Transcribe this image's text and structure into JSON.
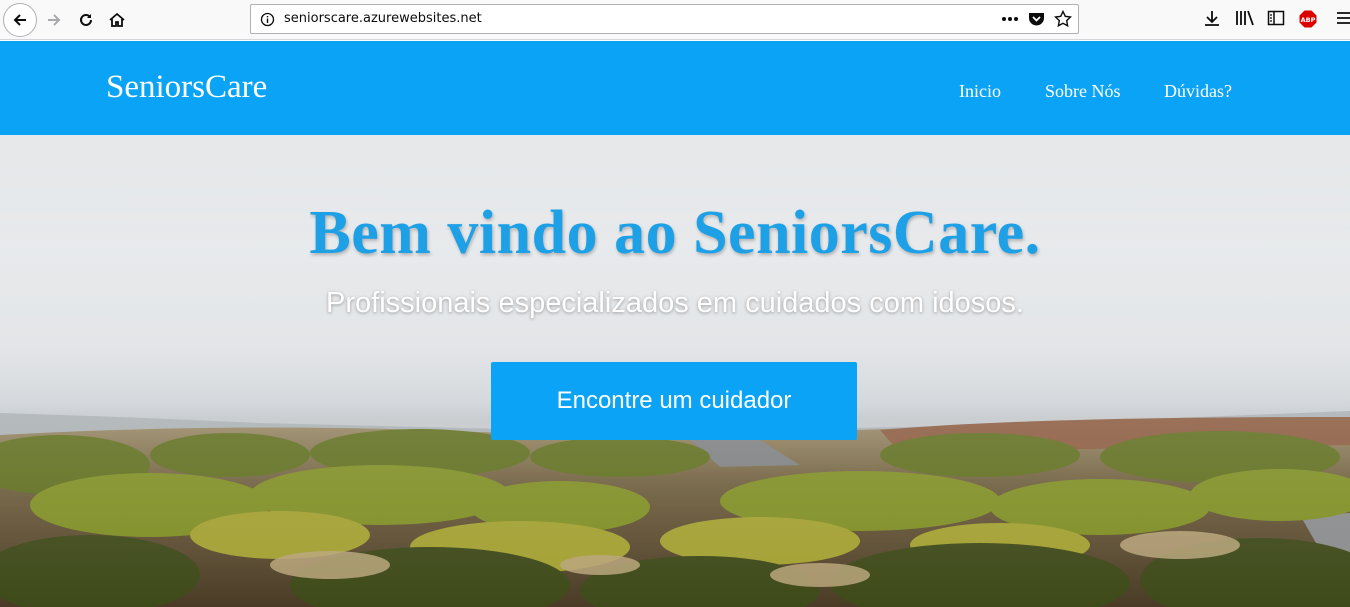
{
  "browser": {
    "url": "seniorscare.azurewebsites.net",
    "abp_label": "ABP",
    "icons": [
      "back-icon",
      "forward-icon",
      "reload-icon",
      "home-icon",
      "info-icon",
      "more-dots-icon",
      "pocket-icon",
      "bookmark-star-icon",
      "download-icon",
      "library-icon",
      "sidebar-icon",
      "adblock-icon",
      "menu-icon"
    ]
  },
  "header": {
    "brand": "SeniorsCare",
    "nav": [
      "Inicio",
      "Sobre Nós",
      "Dúvidas?"
    ],
    "background_color": "#0ba3f6"
  },
  "hero": {
    "title": "Bem vindo ao SeniorsCare.",
    "subtitle": "Profissionais especializados em cuidados com idosos.",
    "cta_label": "Encontre um cuidador",
    "title_color": "#1ea0e6",
    "button_color": "#0ba3f6"
  }
}
